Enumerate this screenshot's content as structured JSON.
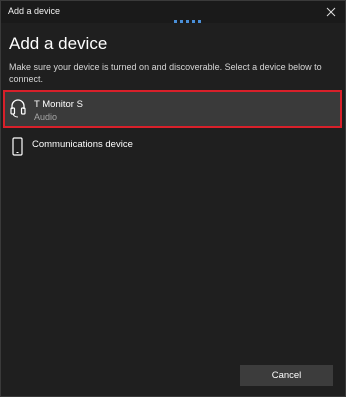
{
  "window": {
    "title": "Add a device"
  },
  "header": {
    "heading": "Add a device",
    "description": "Make sure your device is turned on and discoverable. Select a device below to connect."
  },
  "devices": [
    {
      "name": "T Monitor S",
      "type": "Audio",
      "icon": "headset-icon",
      "selected": true
    },
    {
      "name": "Communications device",
      "type": "",
      "icon": "phone-icon",
      "selected": false
    }
  ],
  "actions": {
    "cancel_label": "Cancel"
  },
  "colors": {
    "background": "#1f1f1f",
    "selection_border": "#d8202a",
    "selected_item_bg": "#3a3a3a",
    "progress_dots": "#4a8fd8"
  }
}
